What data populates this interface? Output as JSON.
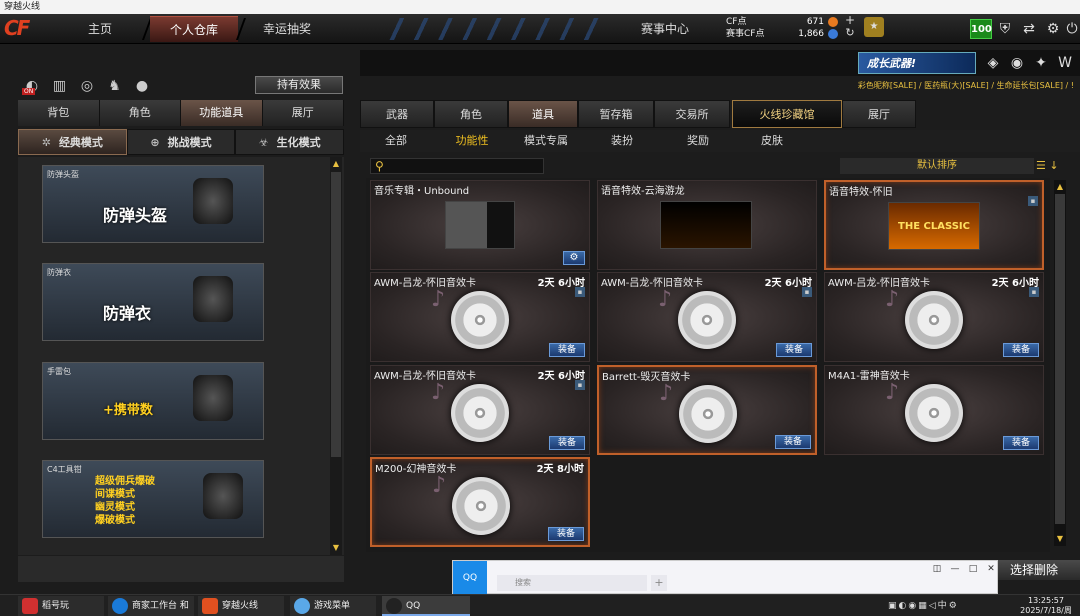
{
  "window": {
    "title": "穿越火线"
  },
  "nav": {
    "logo": "CF",
    "tabs": [
      {
        "label": "主页"
      },
      {
        "label": "个人仓库"
      },
      {
        "label": "幸运抽奖"
      },
      {
        "label": "赛事中心"
      }
    ],
    "cf_label": "CF点",
    "cf_value": "671",
    "match_cf_label": "赛事CF点",
    "match_cf_value": "1,866",
    "level": "100"
  },
  "banner": {
    "text": "成长武器!"
  },
  "ticker": {
    "text": "彩色昵称[SALE] / 医药瓶(大)[SALE] / 生命延长包[SALE] / !"
  },
  "left": {
    "effect_button": "持有效果",
    "on_badge": "ON",
    "tabs": [
      {
        "label": "背包"
      },
      {
        "label": "角色"
      },
      {
        "label": "功能道具"
      },
      {
        "label": "展厅"
      }
    ],
    "modes": [
      {
        "label": "经典模式"
      },
      {
        "label": "挑战模式"
      },
      {
        "label": "生化模式"
      }
    ],
    "items": [
      {
        "title": "防弹头盔",
        "big": "防弹头盔"
      },
      {
        "title": "防弹衣",
        "big": "防弹衣"
      },
      {
        "title": "手雷包",
        "big": "+携带数"
      },
      {
        "title": "C4工具钳",
        "lines": [
          "超级佣兵爆破",
          "间谍模式",
          "幽灵模式",
          "爆破模式"
        ]
      }
    ]
  },
  "right": {
    "tabs": [
      {
        "label": "武器"
      },
      {
        "label": "角色"
      },
      {
        "label": "道具"
      },
      {
        "label": "暂存箱"
      },
      {
        "label": "交易所"
      },
      {
        "label": "火线珍藏馆"
      },
      {
        "label": "展厅"
      }
    ],
    "subtabs": [
      {
        "label": "全部"
      },
      {
        "label": "功能性"
      },
      {
        "label": "模式专属"
      },
      {
        "label": "装扮"
      },
      {
        "label": "奖励"
      },
      {
        "label": "皮肤"
      }
    ],
    "sort_label": "默认排序",
    "delete_button": "选择删除",
    "cards": [
      {
        "title": "音乐专辑・Unbound",
        "duration": "",
        "equip": ""
      },
      {
        "title": "语音特效-云海游龙",
        "duration": "",
        "equip": ""
      },
      {
        "title": "语音特效-怀旧",
        "duration": "",
        "equip": "",
        "image_text": "THE CLASSIC"
      },
      {
        "title": "AWM-吕龙-怀旧音效卡",
        "duration": "2天 6小时",
        "equip": "装备"
      },
      {
        "title": "AWM-吕龙-怀旧音效卡",
        "duration": "2天 6小时",
        "equip": "装备"
      },
      {
        "title": "AWM-吕龙-怀旧音效卡",
        "duration": "2天 6小时",
        "equip": "装备"
      },
      {
        "title": "AWM-吕龙-怀旧音效卡",
        "duration": "2天 6小时",
        "equip": "装备"
      },
      {
        "title": "Barrett-毁灭音效卡",
        "duration": "",
        "equip": "装备"
      },
      {
        "title": "M4A1-雷神音效卡",
        "duration": "",
        "equip": "装备"
      },
      {
        "title": "M200-幻神音效卡",
        "duration": "2天 8小时",
        "equip": "装备"
      }
    ]
  },
  "qq": {
    "logo": "QQ",
    "search_placeholder": "搜索"
  },
  "taskbar": {
    "items": [
      {
        "label": "稻号玩"
      },
      {
        "label": "商家工作台 和阿..."
      },
      {
        "label": "穿越火线"
      },
      {
        "label": "游戏菜单"
      },
      {
        "label": "QQ"
      }
    ],
    "time": "13:25:57",
    "date": "2025/7/18/周五",
    "ime": "中"
  }
}
